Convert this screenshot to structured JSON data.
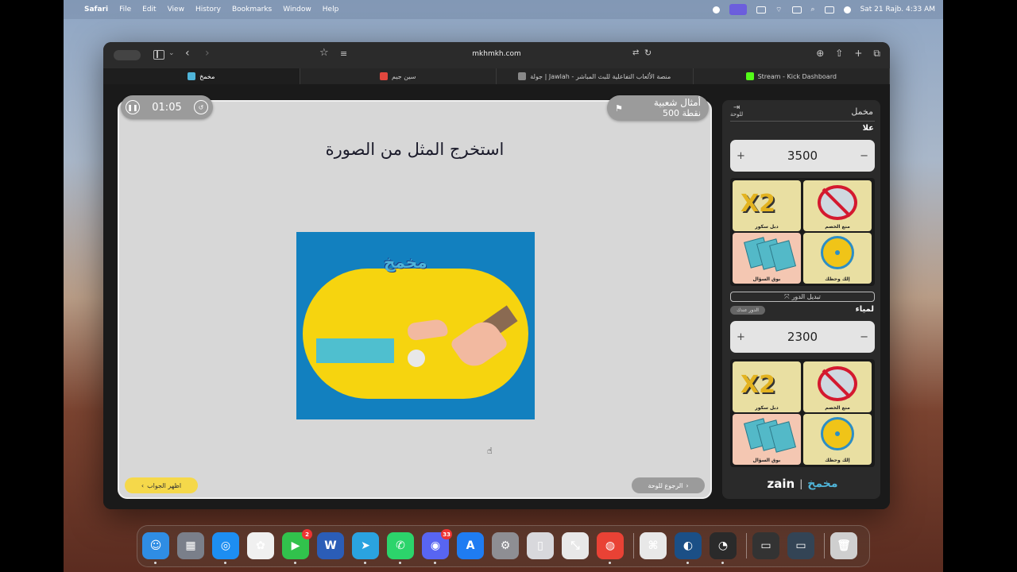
{
  "menubar": {
    "app": "Safari",
    "items": [
      "File",
      "Edit",
      "View",
      "History",
      "Bookmarks",
      "Window",
      "Help"
    ],
    "datetime": "Sat 21 Rajb.  4:33 AM"
  },
  "browser": {
    "url": "mkhmkh.com",
    "tabs": [
      {
        "label": "مخمخ",
        "color": "#4fb4d8"
      },
      {
        "label": "سين جيم",
        "color": "#e2473e"
      },
      {
        "label": "جولة | Jawlah - منصة الألعاب التفاعلية للبث المباشر",
        "color": "#888888"
      },
      {
        "label": "Stream - Kick Dashboard",
        "color": "#53fc18"
      }
    ]
  },
  "game": {
    "timer": "01:05",
    "category": "أمثال شعبية",
    "points": "500 نقطة",
    "question": "استخرج المثل من الصورة",
    "image_logo": "مخمخ",
    "show_answer": "اظهر الجواب",
    "back_to_board": "الرجوع للوحة"
  },
  "panel": {
    "title": "مخمل",
    "exit_label": "للوحة",
    "switch_turn": "تبديل الدور",
    "turn_chip": "الدور عندك",
    "teams": [
      {
        "name": "علا",
        "score": "3500"
      },
      {
        "name": "لمياء",
        "score": "2300"
      }
    ],
    "powers": {
      "double": {
        "label": "دبل سكور",
        "text": "X2"
      },
      "block": {
        "label": "منع الخصم"
      },
      "call": {
        "label": "بوق السؤال"
      },
      "luck": {
        "label": "إلك وحظك"
      }
    },
    "brand_left": "zain",
    "brand_right": "مخمخ"
  },
  "dock": {
    "apps": [
      {
        "name": "finder",
        "color": "#2f8de4",
        "glyph": "☺"
      },
      {
        "name": "launchpad",
        "color": "#7a7f8a",
        "glyph": "▦"
      },
      {
        "name": "safari",
        "color": "#1d8ef2",
        "glyph": "◎"
      },
      {
        "name": "photos",
        "color": "#f0f0f0",
        "glyph": "✿"
      },
      {
        "name": "facetime",
        "color": "#31c24c",
        "glyph": "▶",
        "badge": "2"
      },
      {
        "name": "word",
        "color": "#2b5db7",
        "glyph": "W"
      },
      {
        "name": "telegram",
        "color": "#2aa3e0",
        "glyph": "➤"
      },
      {
        "name": "whatsapp",
        "color": "#2cd46b",
        "glyph": "✆"
      },
      {
        "name": "discord",
        "color": "#5865f2",
        "glyph": "◉",
        "badge": "33"
      },
      {
        "name": "app-store",
        "color": "#1f7cf2",
        "glyph": "A"
      },
      {
        "name": "system-settings",
        "color": "#8e8e93",
        "glyph": "⚙"
      },
      {
        "name": "iphone-mirroring",
        "color": "#d8d8dc",
        "glyph": "▯"
      },
      {
        "name": "remote-app",
        "color": "#e8e8e8",
        "glyph": "⤡"
      },
      {
        "name": "chrome",
        "color": "#e94235",
        "glyph": "◍"
      },
      {
        "name": "automator",
        "color": "#e8e8e8",
        "glyph": "⌘"
      },
      {
        "name": "steam",
        "color": "#1b4f86",
        "glyph": "◐"
      },
      {
        "name": "obs",
        "color": "#2a2a2a",
        "glyph": "◔"
      },
      {
        "name": "recent-window-1",
        "color": "#333333",
        "glyph": "▭"
      },
      {
        "name": "recent-window-2",
        "color": "#334455",
        "glyph": "▭"
      },
      {
        "name": "trash",
        "color": "#cfcfcf",
        "glyph": "🗑"
      }
    ]
  }
}
